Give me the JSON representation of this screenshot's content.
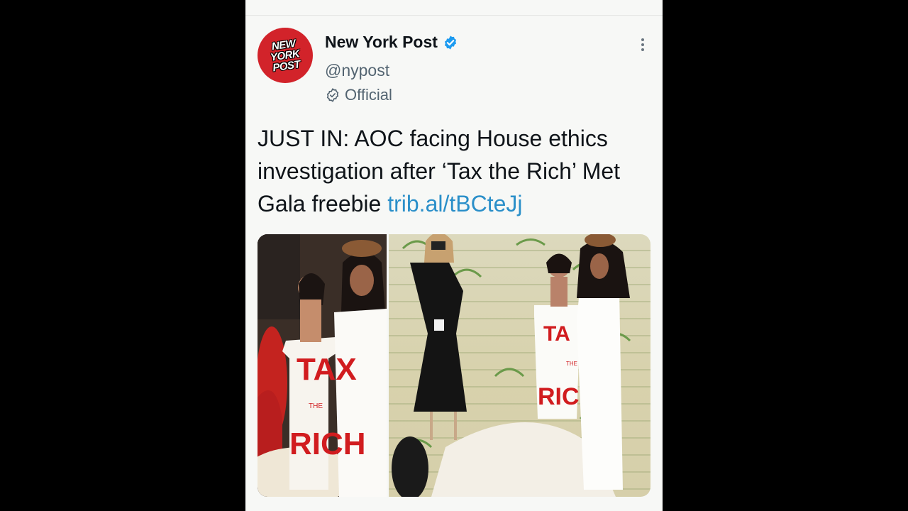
{
  "account": {
    "avatar_text": "NEW\nYORK\nPOST",
    "name": "New York Post",
    "handle": "@nypost",
    "label": "Official"
  },
  "tweet": {
    "text": "JUST IN: AOC facing House ethics investigation after ‘Tax the Rich’ Met Gala freebie ",
    "link": "trib.al/tBCteJj"
  },
  "media": {
    "photo1_alt": "Met Gala photo 1",
    "photo2_alt": "Met Gala photo 2",
    "dress_text_1": "TAX",
    "dress_text_2": "THE",
    "dress_text_3": "RICH"
  },
  "colors": {
    "brand_red": "#d2232a",
    "verified_blue": "#1d9bf0",
    "link_blue": "#2a8fc9"
  }
}
